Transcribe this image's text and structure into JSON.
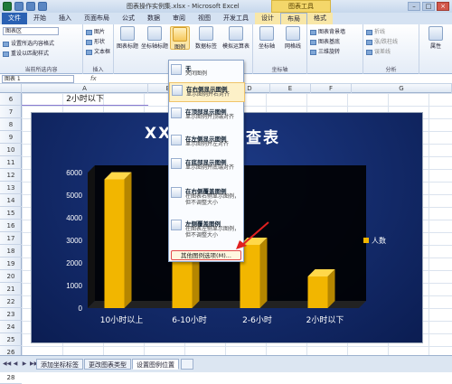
{
  "window": {
    "title": "图表操作实例集.xlsx - Microsoft Excel",
    "context_tab_group": "图表工具"
  },
  "tabs": [
    "文件",
    "开始",
    "插入",
    "页面布局",
    "公式",
    "数据",
    "审阅",
    "视图",
    "开发工具",
    "设计",
    "布局",
    "格式"
  ],
  "ribbon": {
    "current_selection": {
      "dropdown": "图表区",
      "format_selection": "设置所选内容格式",
      "reset_style": "重设以匹配样式",
      "group_label": "当前所选内容"
    },
    "insert": {
      "picture": "图片",
      "shapes": "形状",
      "textbox": "文本框",
      "group_label": "插入"
    },
    "labels": {
      "chart_title": "图表标题",
      "axis_title": "坐标轴标题",
      "legend": "图例",
      "data_labels": "数据标签",
      "data_table": "模拟运算表"
    },
    "axes": {
      "axes": "坐标轴",
      "gridlines": "网格线",
      "group_label": "坐标轴"
    },
    "background": {
      "chart_wall": "图表背景墙",
      "chart_floor": "图表基底",
      "rotation_3d": "三维旋转"
    },
    "analysis": {
      "trendline": "折线",
      "updown_bars": "涨/跌柱线",
      "error_bars": "误差线",
      "group_label": "分析"
    },
    "properties": {
      "label": "属性"
    }
  },
  "formula_bar": {
    "name_box": "图表 1",
    "fx": "fx"
  },
  "columns": [
    "A",
    "B",
    "C",
    "D",
    "E",
    "F",
    "G"
  ],
  "rows": [
    "6",
    "7",
    "8",
    "9",
    "10",
    "11",
    "12",
    "13",
    "14",
    "15",
    "16",
    "17",
    "18",
    "19",
    "20",
    "21",
    "22",
    "23",
    "24",
    "25",
    "26",
    "27",
    "28"
  ],
  "cell_a6": "2小时以下",
  "legend_menu": {
    "items": [
      {
        "title": "无",
        "desc": "关闭图例"
      },
      {
        "title": "在右侧显示图例",
        "desc": "显示图例并右对齐"
      },
      {
        "title": "在顶部显示图例",
        "desc": "显示图例并顶端对齐"
      },
      {
        "title": "在左侧显示图例",
        "desc": "显示图例并左对齐"
      },
      {
        "title": "在底部显示图例",
        "desc": "显示图例并底端对齐"
      },
      {
        "title": "在右侧覆盖图例",
        "desc": "在图表右侧显示图例，但不调整大小"
      },
      {
        "title": "左侧覆盖图例",
        "desc": "在图表左侧显示图例，但不调整大小"
      }
    ],
    "more_options": "其他图例选项(M)..."
  },
  "chart": {
    "title_left": "XX",
    "title_right": "查表",
    "legend": "人数"
  },
  "chart_data": {
    "type": "bar",
    "categories": [
      "10小时以上",
      "6-10小时",
      "2-6小时",
      "2小时以下"
    ],
    "series": [
      {
        "name": "人数",
        "values": [
          5700,
          3500,
          2800,
          1400
        ]
      }
    ],
    "ylim": [
      0,
      6000
    ],
    "yticks": [
      0,
      1000,
      2000,
      3000,
      4000,
      5000,
      6000
    ],
    "bar_color": "#F2B600",
    "background_color": "#0B1D52",
    "legend_position": "right"
  },
  "sheet_tabs": [
    "添加坐标标签",
    "更改图表类型",
    "设置图例位置"
  ]
}
